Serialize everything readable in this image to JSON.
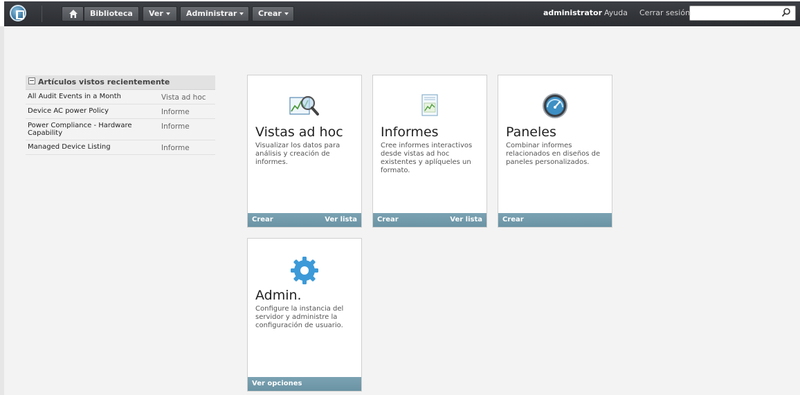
{
  "topbar": {
    "biblioteca": "Biblioteca",
    "ver": "Ver",
    "administrar": "Administrar",
    "crear": "Crear",
    "user": "administrator",
    "ayuda": "Ayuda",
    "cerrar_sesion": "Cerrar sesión",
    "search_value": ""
  },
  "recent": {
    "title": "Artículos vistos recientemente",
    "items": [
      {
        "name": "All Audit Events in a Month",
        "type": "Vista ad hoc"
      },
      {
        "name": "Device AC power Policy",
        "type": "Informe"
      },
      {
        "name": "Power Compliance - Hardware Capability",
        "type": "Informe"
      },
      {
        "name": "Managed Device Listing",
        "type": "Informe"
      }
    ]
  },
  "cards": [
    {
      "title": "Vistas ad hoc",
      "desc": "Visualizar los datos para análisis y creación de informes.",
      "icon": "adhoc-chart-magnifier-icon",
      "footer_left": "Crear",
      "footer_right": "Ver lista"
    },
    {
      "title": "Informes",
      "desc": "Cree informes interactivos desde vistas ad hoc existentes y aplíqueles un formato.",
      "icon": "report-document-icon",
      "footer_left": "Crear",
      "footer_right": "Ver lista"
    },
    {
      "title": "Paneles",
      "desc": "Combinar informes relacionados en diseños de paneles personalizados.",
      "icon": "dashboard-gauge-icon",
      "footer_left": "Crear",
      "footer_right": ""
    },
    {
      "title": "Admin.",
      "desc": "Configure la instancia del servidor y administre la configuración de usuario.",
      "icon": "gear-icon",
      "footer_left": "Ver opciones",
      "footer_right": ""
    }
  ],
  "colors": {
    "topbar": "#2f3236",
    "card_footer": "#6e97a8",
    "accent_blue": "#3d8fc4"
  }
}
